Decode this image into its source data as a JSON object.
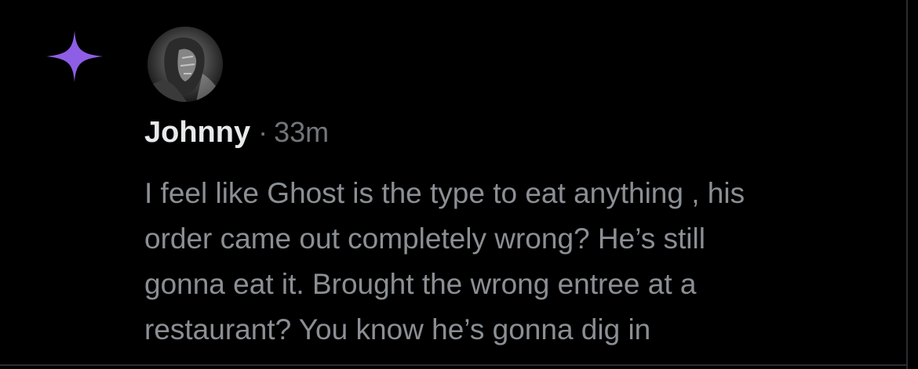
{
  "post": {
    "author_name": "Johnny",
    "separator": "·",
    "timestamp": "33m",
    "text_lines": [
      "I feel like Ghost is the type to eat anything , his",
      "order came out completely wrong? He’s still",
      "gonna eat it. Brought the wrong entree at a",
      "restaurant? You know he’s gonna dig in"
    ]
  },
  "icons": {
    "sparkle": "sparkle-icon",
    "avatar": "avatar"
  },
  "colors": {
    "background": "#000000",
    "accent_sparkle": "#8e5ee6",
    "name": "#e7e9ea",
    "meta": "#71767b",
    "body_text": "#8b8f94",
    "border": "#2a2d31"
  }
}
